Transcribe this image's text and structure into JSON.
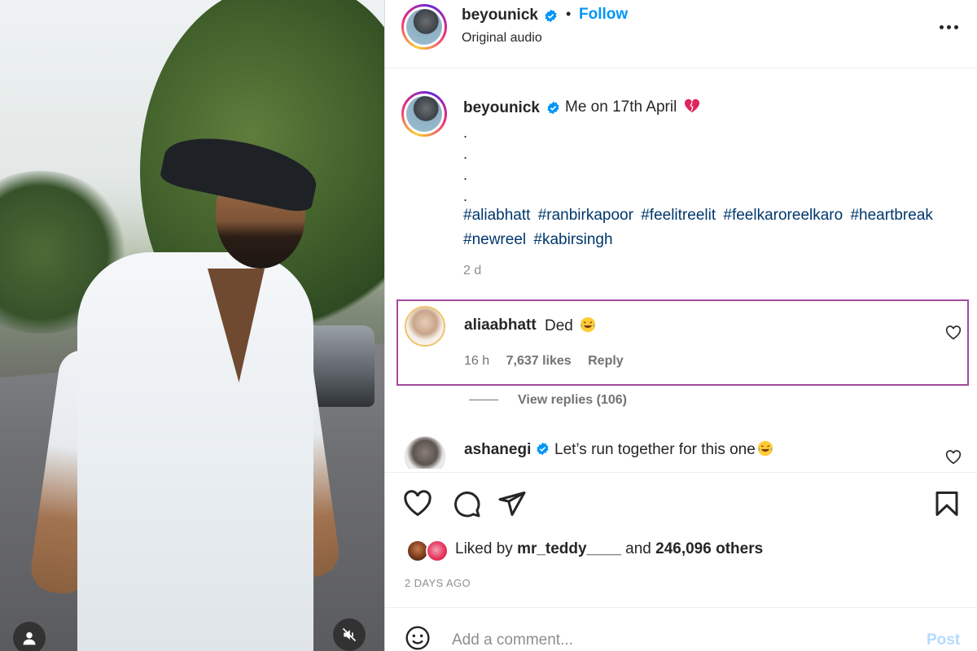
{
  "post": {
    "username": "beyounick",
    "follow_label": "Follow",
    "separator": "•",
    "audio": "Original audio"
  },
  "caption": {
    "username": "beyounick",
    "text": "Me on 17th April",
    "emoji": "broken-heart",
    "dots": [
      ".",
      ".",
      ".",
      "."
    ],
    "hashtags": [
      "#aliabhatt",
      "#ranbirkapoor",
      "#feelitreelit",
      "#feelkaroreelkaro",
      "#heartbreak",
      "#newreel",
      "#kabirsingh"
    ],
    "time": "2 d"
  },
  "comments": [
    {
      "username": "aliaabhatt",
      "text": "Ded",
      "emoji": "face-with-tears-of-joy",
      "time": "16 h",
      "likes": "7,637 likes",
      "reply_label": "Reply",
      "view_replies": "View replies (106)"
    },
    {
      "username": "ashanegi",
      "text": "Let’s run together for this one",
      "emoji": "face-with-tears-of-joy"
    }
  ],
  "likes": {
    "prefix": "Liked by",
    "user": "mr_teddy____",
    "and": "and",
    "count": "246,096 others"
  },
  "date": "2 DAYS AGO",
  "add_comment": {
    "placeholder": "Add a comment...",
    "post_label": "Post"
  },
  "icons": {
    "verified": "verified-badge-icon",
    "more": "more-options-icon",
    "like": "heart-icon",
    "comment": "comment-icon",
    "share": "paper-plane-icon",
    "save": "bookmark-icon",
    "emoji": "emoji-icon",
    "user": "user-icon",
    "mute": "muted-speaker-icon"
  },
  "colors": {
    "accent": "#0095f6",
    "hashtag": "#00376b",
    "highlight_border": "#a24b9b",
    "post_disabled": "#b3dbff"
  }
}
